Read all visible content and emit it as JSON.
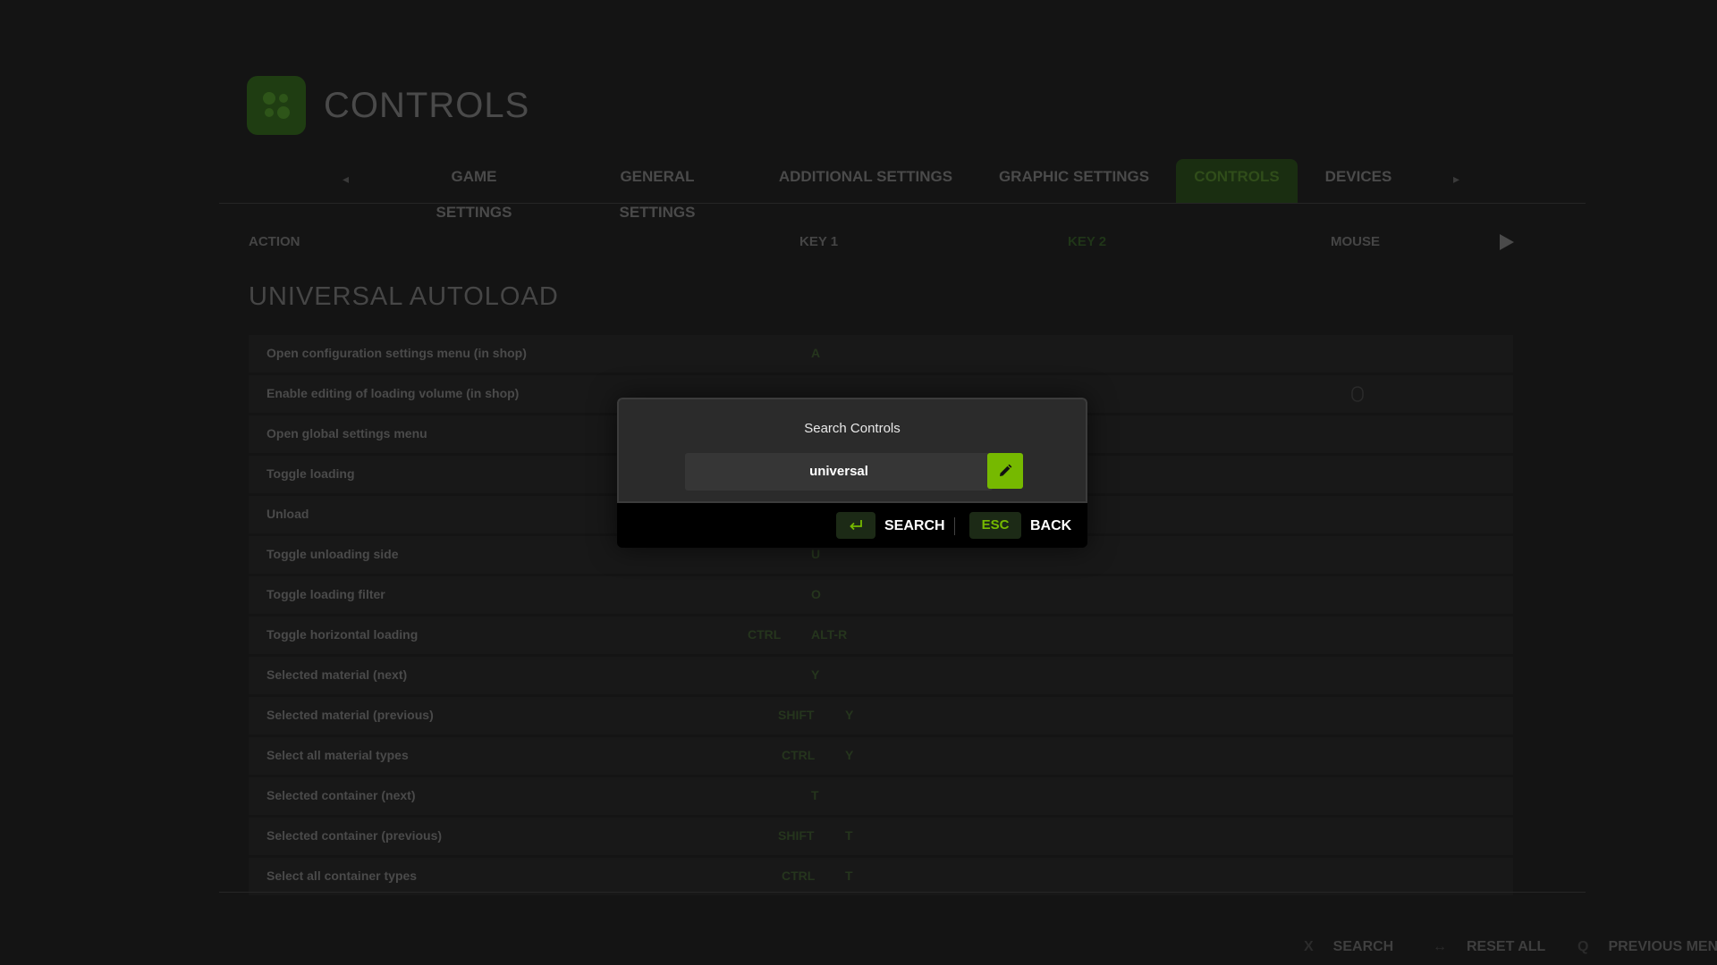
{
  "header": {
    "title": "CONTROLS"
  },
  "tabs": [
    {
      "label": "GAME SETTINGS"
    },
    {
      "label": "GENERAL SETTINGS"
    },
    {
      "label": "ADDITIONAL SETTINGS"
    },
    {
      "label": "GRAPHIC SETTINGS"
    },
    {
      "label": "CONTROLS",
      "active": true
    },
    {
      "label": "DEVICES"
    }
  ],
  "columns": {
    "action": "ACTION",
    "key1": "KEY 1",
    "key2": "KEY 2",
    "mouse": "MOUSE"
  },
  "section": {
    "title": "UNIVERSAL AUTOLOAD"
  },
  "rows": [
    {
      "label": "Open configuration settings menu (in shop)",
      "key1": "A"
    },
    {
      "label": "Enable editing of loading volume (in shop)",
      "key1": ""
    },
    {
      "label": "Open global settings menu",
      "key1": ""
    },
    {
      "label": "Toggle loading",
      "key1": ""
    },
    {
      "label": "Unload",
      "key1": ""
    },
    {
      "label": "Toggle unloading side",
      "key1": "U"
    },
    {
      "label": "Toggle loading filter",
      "key1": "O"
    },
    {
      "label": "Toggle horizontal loading",
      "key1a": "CTRL",
      "key1b": "ALT-R"
    },
    {
      "label": "Selected material (next)",
      "key1": "Y"
    },
    {
      "label": "Selected material (previous)",
      "key1a": "SHIFT",
      "key1b": "Y"
    },
    {
      "label": "Select all material types",
      "key1a": "CTRL",
      "key1b": "Y"
    },
    {
      "label": "Selected container (next)",
      "key1": "T"
    },
    {
      "label": "Selected container (previous)",
      "key1a": "SHIFT",
      "key1b": "T"
    },
    {
      "label": "Select all container types",
      "key1a": "CTRL",
      "key1b": "T"
    }
  ],
  "footer": [
    {
      "key": "X",
      "label": "SEARCH"
    },
    {
      "key": "↔",
      "label": "RESET ALL"
    },
    {
      "key": "Q",
      "label": "PREVIOUS MENU"
    }
  ],
  "modal": {
    "title": "Search Controls",
    "search_value": "universal",
    "confirm_label": "SEARCH",
    "esc_key": "ESC",
    "back_label": "BACK"
  },
  "colors": {
    "accent": "#76b900",
    "background": "#141414"
  },
  "icons": [
    "gear-icon",
    "chevron-left-icon",
    "chevron-right-icon",
    "play-icon",
    "pencil-icon",
    "enter-icon",
    "mouse-icon"
  ]
}
